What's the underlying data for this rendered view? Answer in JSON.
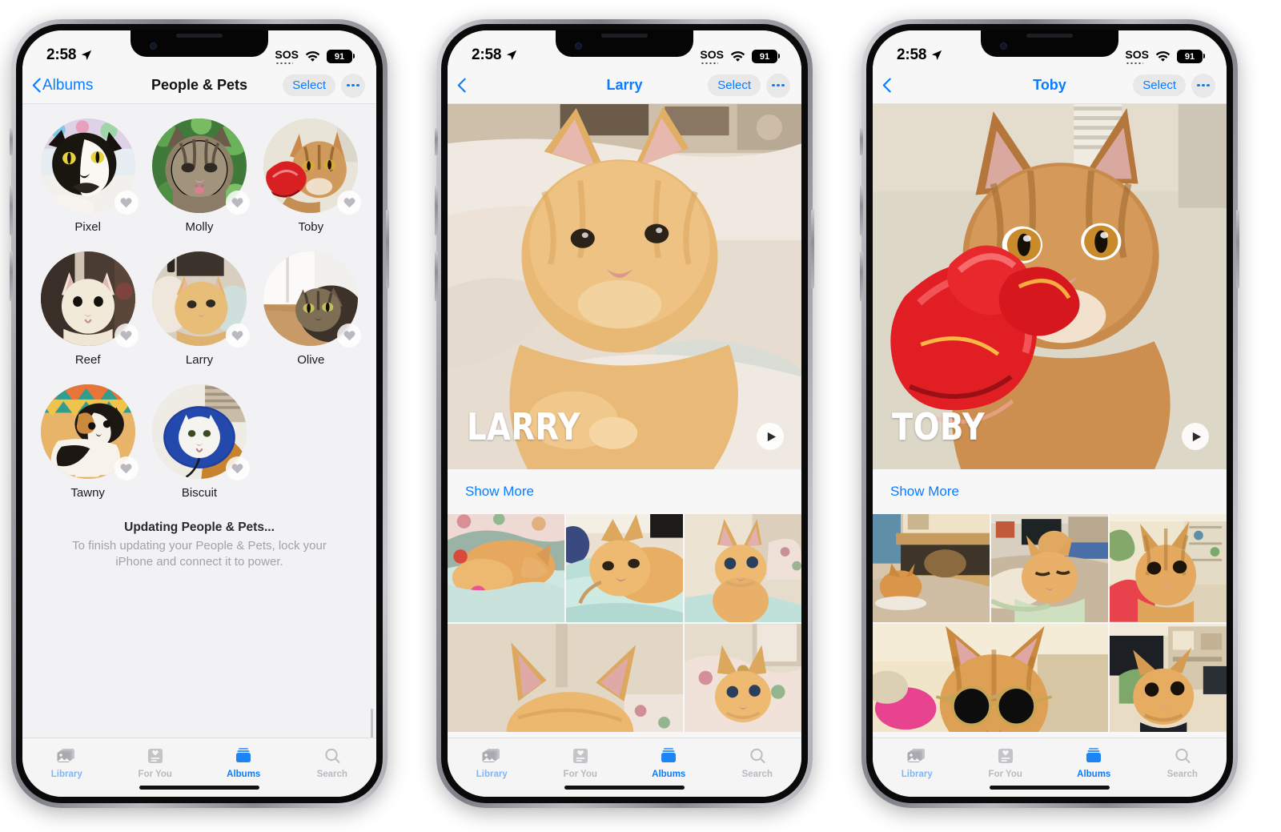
{
  "status_bar": {
    "time": "2:58",
    "sos": "SOS",
    "battery": "91",
    "location_icon": "location-arrow-icon",
    "wifi_icon": "wifi-icon"
  },
  "colors": {
    "accent_blue": "#0a7cff",
    "tab_inactive": "#b9b9bf",
    "screen_bg": "#f2f2f4",
    "muted_text": "#a2a2a7"
  },
  "phones": [
    {
      "id": "people-and-pets",
      "nav": {
        "back_label": "Albums",
        "title": "People & Pets",
        "select_label": "Select",
        "more_label": "more-options"
      },
      "pets": [
        {
          "name": "Pixel",
          "fav": "heart-icon"
        },
        {
          "name": "Molly",
          "fav": "heart-icon"
        },
        {
          "name": "Toby",
          "fav": "heart-icon"
        },
        {
          "name": "Reef",
          "fav": "heart-icon"
        },
        {
          "name": "Larry",
          "fav": "heart-icon"
        },
        {
          "name": "Olive",
          "fav": "heart-icon"
        },
        {
          "name": "Tawny",
          "fav": "heart-icon"
        },
        {
          "name": "Biscuit",
          "fav": "heart-icon"
        }
      ],
      "update": {
        "title": "Updating People & Pets...",
        "subtitle": "To finish updating your People & Pets, lock your iPhone and connect it to power."
      }
    },
    {
      "id": "larry-album",
      "nav": {
        "back_label": "",
        "title": "Larry",
        "select_label": "Select",
        "more_label": "more-options"
      },
      "hero": {
        "overlay_title": "LARRY",
        "play_label": "play-memory"
      },
      "show_more": "Show More"
    },
    {
      "id": "toby-album",
      "nav": {
        "back_label": "",
        "title": "Toby",
        "select_label": "Select",
        "more_label": "more-options"
      },
      "hero": {
        "overlay_title": "TOBY",
        "play_label": "play-memory"
      },
      "show_more": "Show More"
    }
  ],
  "tabs": [
    {
      "label": "Library",
      "icon": "photos-library-icon",
      "state": "library"
    },
    {
      "label": "For You",
      "icon": "for-you-icon",
      "state": "inactive"
    },
    {
      "label": "Albums",
      "icon": "albums-icon",
      "state": "active"
    },
    {
      "label": "Search",
      "icon": "search-icon",
      "state": "inactive"
    }
  ]
}
